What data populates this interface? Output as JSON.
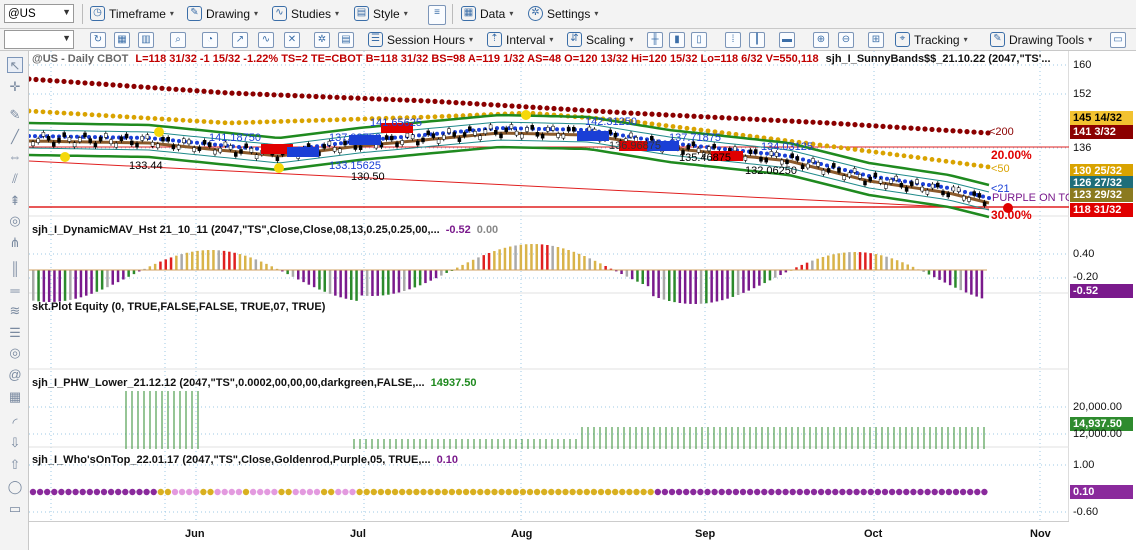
{
  "toolbar1": {
    "symbol": "@US",
    "timeframe": "Timeframe",
    "drawing": "Drawing",
    "studies": "Studies",
    "style": "Style",
    "data": "Data",
    "settings": "Settings"
  },
  "toolbar2": {
    "session_hours": "Session Hours",
    "interval": "Interval",
    "scaling": "Scaling",
    "tracking": "Tracking",
    "drawing_tools": "Drawing Tools"
  },
  "chart": {
    "header": "@US - Daily  CBOT",
    "ohlc": "L=118 31/32  -1 15/32  -1.22%  TS=2  TE=CBOT  B=118 31/32  BS=98  A=119 1/32  AS=48  O=120 13/32  Hi=120 15/32  Lo=118 6/32  V=550,118",
    "study": "sjh_I_SunnyBands$$_21.10.22 (2047,\"TS'...",
    "annotations": {
      "a1": "141.18750",
      "a2": "141.65625",
      "a3": "137.93750",
      "a4": "133.44",
      "a5": "133.15625",
      "a6": "130.50",
      "a7": "142.31250",
      "a8": "136.96875",
      "a9": "135.46875",
      "a10": "134.03125",
      "a11": "132.06250",
      "a12": "137.71875"
    },
    "labels": {
      "lt200": "<200",
      "pct20": "20.00%",
      "lt50": "<50",
      "lt21": "<21",
      "purple": "PURPLE ON TOP",
      "pct30": "30.00%"
    }
  },
  "panels": [
    {
      "title": "sjh_I_DynamicMAV_Hst 21_10_11 (2047,\"TS\",Close,Close,08,13,0.25,0.25,00,...",
      "v1": "-0.52",
      "v2": "0.00"
    },
    {
      "title": "skt.Plot Equity (0, TRUE,FALSE,FALSE, TRUE,07, TRUE)",
      "v1": "",
      "v2": ""
    },
    {
      "title": "sjh_I_PHW_Lower_21.12.12 (2047,\"TS\",0.0002,00,00,00,darkgreen,FALSE,...",
      "v1": "14937.50",
      "v2": ""
    },
    {
      "title": "sjh_I_Who'sOnTop_22.01.17 (2047,\"TS\",Close,Goldenrod,Purple,05, TRUE,...",
      "v1": "0.10",
      "v2": ""
    }
  ],
  "price_axis": {
    "ticks": [
      "160",
      "152",
      "136",
      "0.40",
      "-0.20",
      "20,000.00",
      "12,000.00",
      "1.00",
      "-0.60"
    ],
    "tags": [
      "145 14/32",
      "141 3/32",
      "130 25/32",
      "126 27/32",
      "123 29/32",
      "118 31/32",
      "-0.52",
      "14,937.50",
      "0.10"
    ]
  },
  "x_axis": [
    "Jun",
    "Jul",
    "Aug",
    "Sep",
    "Oct",
    "Nov"
  ],
  "colors": {
    "band_green": "#1f8a1f",
    "ma200": "#8b0000",
    "ma50": "#d9a300",
    "ma21": "#1a3fd6",
    "hist_purple": "#7a1a8c",
    "hist_green": "#2c8a2c",
    "hist_gold": "#d9b44a",
    "hist_red": "#e02020",
    "phw_green": "#2e8b2e",
    "dot_purple": "#8a2a9c",
    "dot_gold": "#d9b020",
    "dot_pink": "#e39adf"
  },
  "icons": [
    "search-icon",
    "timeframe-icon",
    "drawing-icon",
    "studies-icon",
    "style-icon",
    "data-icon",
    "settings-icon",
    "tracking-icon",
    "crosshair-icon"
  ]
}
